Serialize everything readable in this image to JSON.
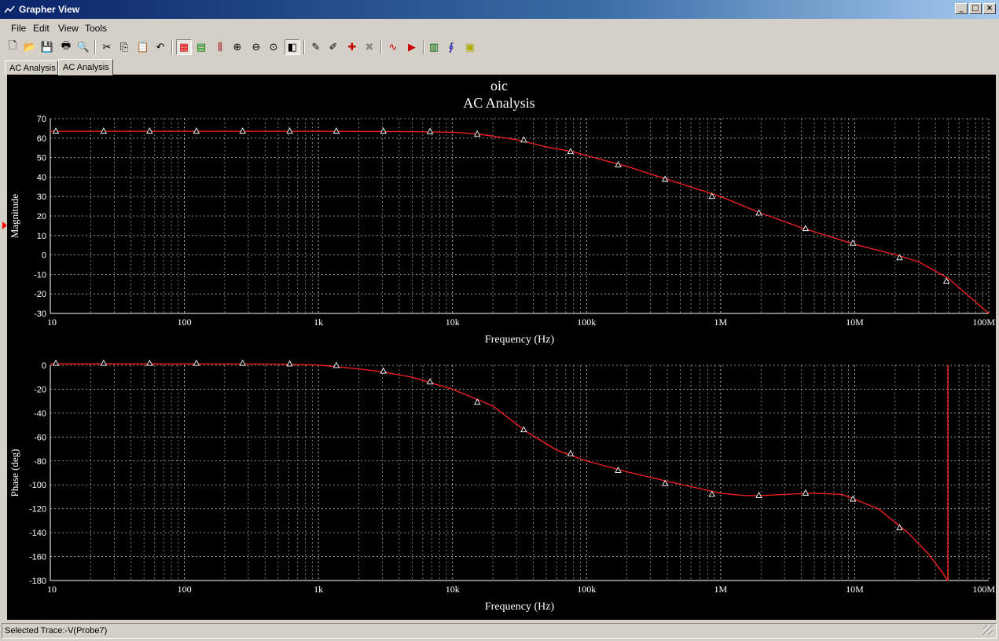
{
  "window": {
    "title": "Grapher View",
    "controls": [
      "_",
      "□",
      "×"
    ]
  },
  "menu": [
    "File",
    "Edit",
    "View",
    "Tools"
  ],
  "toolbar": [
    "new-icon",
    "open-icon",
    "save-icon",
    "print-icon",
    "print-preview-icon",
    "cut-icon",
    "copy-icon",
    "paste-icon",
    "undo-icon",
    "grid-icon",
    "legend-icon",
    "cursor-icon",
    "zoom-in-icon",
    "zoom-out-icon",
    "zoom-full-icon",
    "reverse-colors-icon",
    "select-marks-icon",
    "select-trace-icon",
    "add-trace-icon",
    "remove-trace-icon",
    "overlay-traces-icon",
    "export-icon",
    "excel-export-icon",
    "mathcad-export-icon",
    "labview-export-icon"
  ],
  "tabs": [
    {
      "label": "AC Analysis"
    },
    {
      "label": "AC Analysis",
      "active": true
    }
  ],
  "status": {
    "selected_trace": "Selected Trace:-V(Probe7)"
  },
  "colors": {
    "trace": "#ff2020",
    "grid": "#ffffff",
    "background": "#000000"
  },
  "chart_data": {
    "title": "oic",
    "subtitle": "AC Analysis",
    "panels": [
      {
        "type": "line",
        "ylabel": "Magnitude",
        "xlabel": "Frequency (Hz)",
        "xscale": "log",
        "xlim": [
          10,
          100000000
        ],
        "ylim": [
          -30,
          70
        ],
        "yticks": [
          70,
          60,
          50,
          40,
          30,
          20,
          10,
          0,
          -10,
          -20,
          -30
        ],
        "xticks": [
          {
            "v": 10,
            "label": "10"
          },
          {
            "v": 100,
            "label": "100"
          },
          {
            "v": 1000,
            "label": "1k"
          },
          {
            "v": 10000,
            "label": "10k"
          },
          {
            "v": 100000,
            "label": "100k"
          },
          {
            "v": 1000000,
            "label": "1M"
          },
          {
            "v": 10000000,
            "label": "10M"
          },
          {
            "v": 100000000,
            "label": "100M"
          }
        ],
        "grid": true,
        "series": [
          {
            "x": [
              10,
              100,
              1000,
              5000,
              10000,
              15000,
              20000,
              30000,
              50000,
              80000,
              100000,
              200000,
              400000,
              1000000,
              2000000,
              4000000,
              10000000,
              20000000,
              30000000,
              50000000,
              100000000
            ],
            "y": [
              63.5,
              63.5,
              63.5,
              63.3,
              63,
              62.2,
              61,
              59.2,
              55.5,
              53,
              51,
              45.5,
              38.8,
              30,
              21.5,
              14,
              5.5,
              0.2,
              -3.5,
              -12,
              -30
            ],
            "markers_x": [
              11,
              25,
              55,
              123,
              272,
              610,
              1360,
              3050,
              6800,
              15300,
              34000,
              76000,
              172000,
              385000,
              860000,
              1930000,
              4300000,
              9700000,
              21600000,
              48300000
            ],
            "markers_y": [
              63.5,
              63.5,
              63.5,
              63.5,
              63.5,
              63.5,
              63.5,
              63.5,
              63.3,
              62,
              59,
              53,
              46.2,
              38.8,
              30,
              21.5,
              13.5,
              6,
              -1.5,
              -13.5
            ]
          }
        ]
      },
      {
        "type": "line",
        "ylabel": "Phase (deg)",
        "xlabel": "Frequency (Hz)",
        "xscale": "log",
        "xlim": [
          10,
          100000000
        ],
        "ylim": [
          -180,
          0
        ],
        "yticks": [
          0,
          -20,
          -40,
          -60,
          -80,
          -100,
          -120,
          -140,
          -160,
          -180
        ],
        "xticks": [
          {
            "v": 10,
            "label": "10"
          },
          {
            "v": 100,
            "label": "100"
          },
          {
            "v": 1000,
            "label": "1k"
          },
          {
            "v": 10000,
            "label": "10k"
          },
          {
            "v": 100000,
            "label": "100k"
          },
          {
            "v": 1000000,
            "label": "1M"
          },
          {
            "v": 10000000,
            "label": "10M"
          },
          {
            "v": 100000000,
            "label": "100M"
          }
        ],
        "grid": true,
        "series": [
          {
            "x": [
              10,
              100,
              500,
              1000,
              2000,
              3000,
              5000,
              10000,
              20000,
              35000,
              60000,
              100000,
              200000,
              400000,
              1000000,
              1500000,
              2000000,
              3000000,
              5000000,
              8000000,
              10000000,
              15000000,
              25000000,
              35000000,
              45000000,
              49000000,
              49500000,
              49500000
            ],
            "y": [
              1.2,
              1.2,
              1,
              0.2,
              -3,
              -5.5,
              -10,
              -20,
              -34,
              -55,
              -71,
              -80,
              -89,
              -97,
              -107,
              -109,
              -109,
              -108,
              -107,
              -108,
              -112,
              -120,
              -140,
              -157,
              -173,
              -180,
              -180,
              0
            ],
            "markers_x": [
              11,
              25,
              55,
              123,
              272,
              610,
              1360,
              3050,
              6800,
              15300,
              34000,
              76000,
              172000,
              385000,
              860000,
              1930000,
              4300000,
              9700000,
              21600000
            ],
            "markers_y": [
              1.5,
              1.5,
              1.5,
              1.5,
              1.5,
              1,
              -0.3,
              -5,
              -14,
              -31,
              -54,
              -74,
              -88,
              -99,
              -108,
              -109,
              -107,
              -112,
              -136
            ]
          }
        ]
      }
    ]
  }
}
